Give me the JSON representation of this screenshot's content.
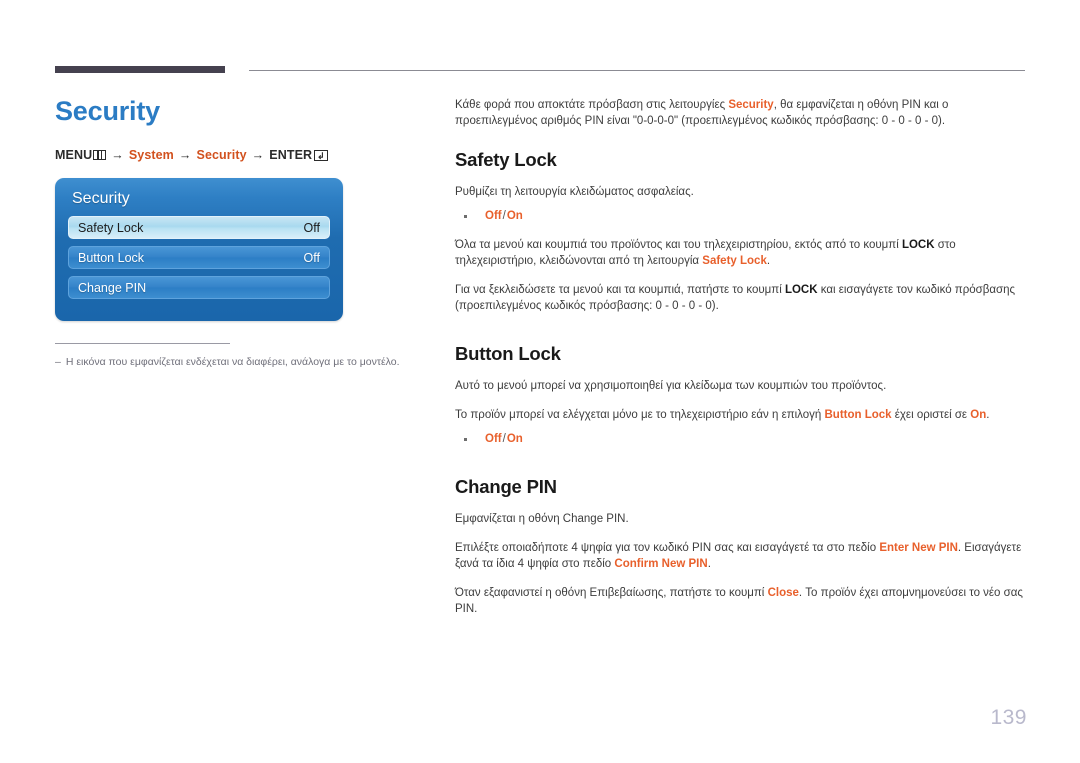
{
  "page": {
    "number": "139",
    "title": "Security"
  },
  "breadcrumb": {
    "menu_label": "MENU",
    "menu_icon": "menu-bars-icon",
    "arrow": "→",
    "system_label": "System",
    "security_label": "Security",
    "enter_label": "ENTER",
    "enter_icon": "enter-return-icon",
    "accent_color": "#d2511e"
  },
  "osd": {
    "title": "Security",
    "rows": [
      {
        "label": "Safety Lock",
        "value": "Off",
        "selected": true
      },
      {
        "label": "Button Lock",
        "value": "Off",
        "selected": false
      },
      {
        "label": "Change PIN",
        "value": "",
        "selected": false
      }
    ]
  },
  "footnote": {
    "dash": "–",
    "text": "Η εικόνα που εμφανίζεται ενδέχεται να διαφέρει, ανάλογα με το μοντέλο."
  },
  "intro": {
    "part1": "Κάθε φορά που αποκτάτε πρόσβαση στις λειτουργίες ",
    "accent1": "Security",
    "part2": ", θα εμφανίζεται η οθόνη PIN και ο προεπιλεγμένος αριθμός PIN είναι \"0-0-0-0\" (προεπιλεγμένος κωδικός πρόσβασης: 0 - 0 - 0 - 0)."
  },
  "sections": {
    "safety_lock": {
      "heading": "Safety Lock",
      "para1": "Ρυθμίζει τη λειτουργία κλειδώματος ασφαλείας.",
      "bullet": {
        "off": "Off",
        "sep": "/",
        "on": "On"
      },
      "para2_part1": "Όλα τα μενού και κουμπιά του προϊόντος και του τηλεχειριστηρίου, εκτός από το κουμπί ",
      "para2_bold": "LOCK",
      "para2_part2": " στο τηλεχειριστήριο, κλειδώνονται από τη λειτουργία ",
      "para2_accent": "Safety Lock",
      "para2_part3": ".",
      "para3_part1": "Για να ξεκλειδώσετε τα μενού και τα κουμπιά, πατήστε το κουμπί ",
      "para3_bold": "LOCK",
      "para3_part2": " και εισαγάγετε τον κωδικό πρόσβασης (προεπιλεγμένος κωδικός πρόσβασης: 0 - 0 - 0 - 0)."
    },
    "button_lock": {
      "heading": "Button Lock",
      "para1": "Αυτό το μενού μπορεί να χρησιμοποιηθεί για κλείδωμα των κουμπιών του προϊόντος.",
      "para2_part1": "Το προϊόν μπορεί να ελέγχεται μόνο με το τηλεχειριστήριο εάν η επιλογή ",
      "para2_accent1": "Button Lock",
      "para2_part2": " έχει οριστεί σε ",
      "para2_accent2": "On",
      "para2_part3": ".",
      "bullet": {
        "off": "Off",
        "sep": "/",
        "on": "On"
      }
    },
    "change_pin": {
      "heading": "Change PIN",
      "para1": "Εμφανίζεται η οθόνη Change PIN.",
      "para2_part1": "Επιλέξτε οποιαδήποτε 4 ψηφία για τον κωδικό PIN σας και εισαγάγετέ τα στο πεδίο ",
      "para2_accent1": "Enter New PIN",
      "para2_part2": ". Εισαγάγετε ξανά τα ίδια 4 ψηφία στο πεδίο ",
      "para2_accent2": "Confirm New PIN",
      "para2_part3": ".",
      "para3_part1": "Όταν εξαφανιστεί η οθόνη Επιβεβαίωσης, πατήστε το κουμπί ",
      "para3_accent": "Close",
      "para3_part2": ". Το προϊόν έχει απομνημονεύσει το νέο σας PIN."
    }
  }
}
